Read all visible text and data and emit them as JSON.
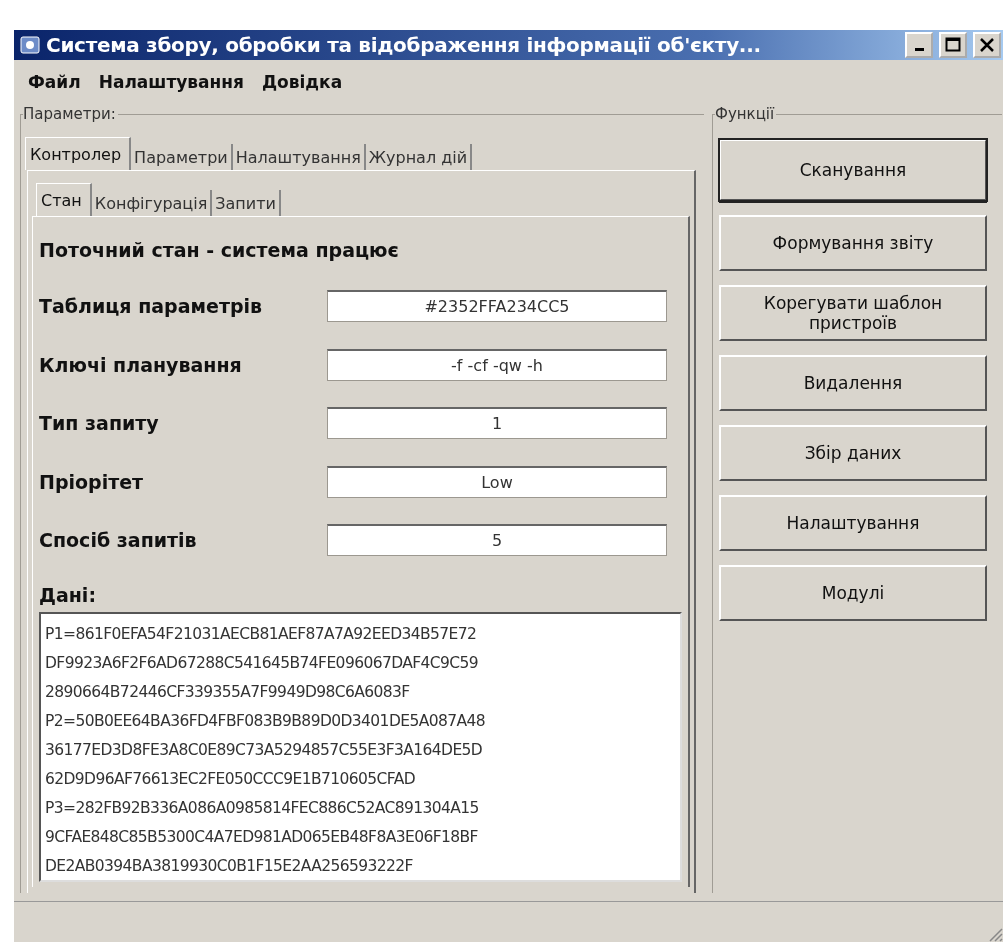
{
  "window": {
    "title": "Система збору, обробки та відображення інформації об'єкту..."
  },
  "menu": [
    "Файл",
    "Налаштування",
    "Довідка"
  ],
  "parameters": {
    "title": "Параметри:",
    "tabs": [
      {
        "label": "Контролер",
        "selected": true
      },
      {
        "label": "Параметри",
        "selected": false
      },
      {
        "label": "Налаштування",
        "selected": false
      },
      {
        "label": "Журнал дій",
        "selected": false
      }
    ],
    "subtabs": [
      {
        "label": "Стан",
        "selected": true
      },
      {
        "label": "Конфігурація",
        "selected": false
      },
      {
        "label": "Запити",
        "selected": false
      }
    ],
    "status": "Поточний стан - система працює",
    "fields": [
      {
        "label": "Таблиця параметрів",
        "value": "#2352FFA234CC5"
      },
      {
        "label": "Ключі планування",
        "value": "-f -cf -qw -h"
      },
      {
        "label": "Тип запиту",
        "value": "1"
      },
      {
        "label": "Пріорітет",
        "value": "Low"
      },
      {
        "label": "Спосіб запитів",
        "value": "5"
      }
    ],
    "data_label": "Дані:",
    "data_lines": [
      "P1=861F0EFA54F21031AECB81AEF87A7A92EED34B57E72",
      "DF9923A6F2F6AD67288C541645B74FE096067DAF4C9C59",
      "2890664B72446CF339355A7F9949D98C6A6083F",
      "P2=50B0EE64BA36FD4FBF083B9B89D0D3401DE5A087A48",
      "36177ED3D8FE3A8C0E89C73A5294857C55E3F3A164DE5D",
      "62D9D96AF76613EC2FE050CCC9E1B710605CFAD",
      "P3=282FB92B336A086A0985814FEC886C52AC891304A15",
      "9CFAE848C85B5300C4A7ED981AD065EB48F8A3E06F18BF",
      "DE2AB0394BA3819930C0B1F15E2AA256593222F"
    ]
  },
  "functions": {
    "title": "Функції",
    "buttons": [
      {
        "label": "Сканування",
        "default": true
      },
      {
        "label": "Формування звіту",
        "default": false
      },
      {
        "label": "Корегувати шаблон пристроїв",
        "default": false
      },
      {
        "label": "Видалення",
        "default": false
      },
      {
        "label": "Збір даних",
        "default": false
      },
      {
        "label": "Налаштування",
        "default": false
      },
      {
        "label": "Модулі",
        "default": false
      }
    ]
  }
}
